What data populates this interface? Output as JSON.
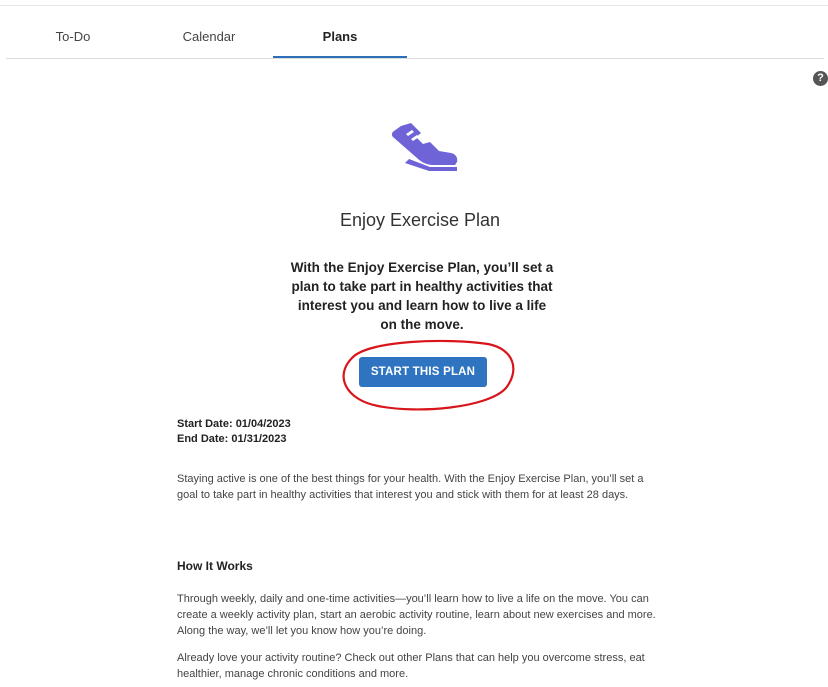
{
  "tabs": [
    {
      "label": "To-Do"
    },
    {
      "label": "Calendar"
    },
    {
      "label": "Plans"
    }
  ],
  "active_tab": "Plans",
  "help_icon": {
    "icon": "question-circle-icon",
    "glyph": "?"
  },
  "plan": {
    "icon": "running-shoe-icon",
    "icon_color": "#6f63d8",
    "title": "Enjoy Exercise Plan",
    "intro": "With the Enjoy Exercise Plan, you’ll set a plan to take part in healthy activities that interest you and learn how to live a life on the move.",
    "start_button_label": "START THIS PLAN",
    "start_date_label": "Start Date:",
    "start_date": "01/04/2023",
    "end_date_label": "End Date:",
    "end_date": "01/31/2023",
    "description": "Staying active is one of the best things for your health. With the Enjoy Exercise Plan, you’ll set a goal to take part in healthy activities that interest you and stick with them for at least 28 days.",
    "how_it_works_heading": "How It Works",
    "how_it_works_text": "Through weekly, daily and one-time activities—you’ll learn how to live a life on the move. You can create a weekly activity plan, start an aerobic activity routine, learn about new exercises and more. Along the way, we’ll let you know how you’re doing.",
    "closing_text": "Already love your activity routine? Check out other Plans that can help you overcome stress, eat healthier, manage chronic conditions and more."
  },
  "colors": {
    "accent": "#2f74c0",
    "annotation": "#d9141b"
  }
}
